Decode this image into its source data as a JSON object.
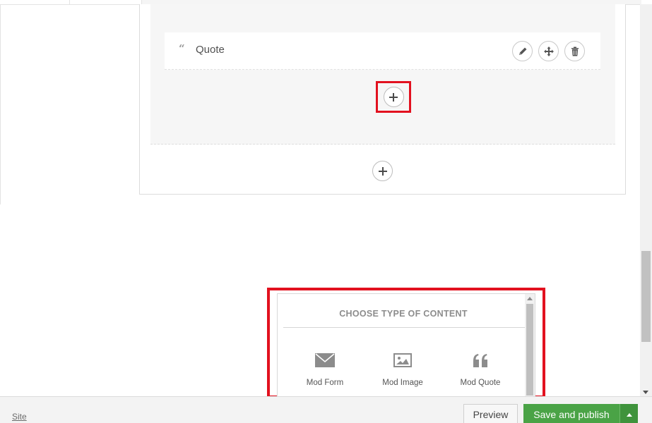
{
  "editor": {
    "content_item": {
      "icon": "quote-icon",
      "glyph": "“",
      "label": "Quote"
    },
    "row_actions": [
      {
        "name": "edit-button",
        "icon": "pencil-icon"
      },
      {
        "name": "move-button",
        "icon": "move-arrows-icon"
      },
      {
        "name": "delete-button",
        "icon": "trash-icon"
      }
    ],
    "add_content_icon": "plus-icon"
  },
  "chooser": {
    "title": "CHOOSE TYPE OF CONTENT",
    "items": [
      {
        "label": "Mod Form",
        "icon": "envelope-icon"
      },
      {
        "label": "Mod Image",
        "icon": "image-icon"
      },
      {
        "label": "Mod Quote",
        "icon": "quote-icon"
      }
    ]
  },
  "footer": {
    "site_link": "Site",
    "preview_label": "Preview",
    "publish_label": "Save and publish"
  },
  "colors": {
    "highlight": "#e2111f",
    "publish_green": "#4aa346",
    "icon_gray": "#8c8c8c"
  }
}
